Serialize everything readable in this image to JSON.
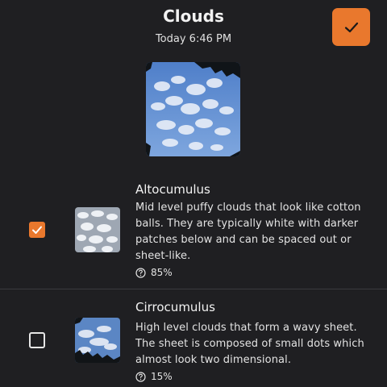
{
  "header": {
    "title": "Clouds",
    "time": "Today 6:46 PM",
    "confirm_icon": "check-icon"
  },
  "colors": {
    "accent": "#e9782d",
    "background": "#1f1f22"
  },
  "results": [
    {
      "name": "Altocumulus",
      "description": "Mid level puffy clouds that look like cotton balls. They are typically white with darker patches below and can be spaced out or sheet-like.",
      "confidence": "85%",
      "checked": true
    },
    {
      "name": "Cirrocumulus",
      "description": "High level clouds that form a wavy sheet. The sheet is composed of small dots which almost look two dimensional.",
      "confidence": "15%",
      "checked": false
    }
  ]
}
